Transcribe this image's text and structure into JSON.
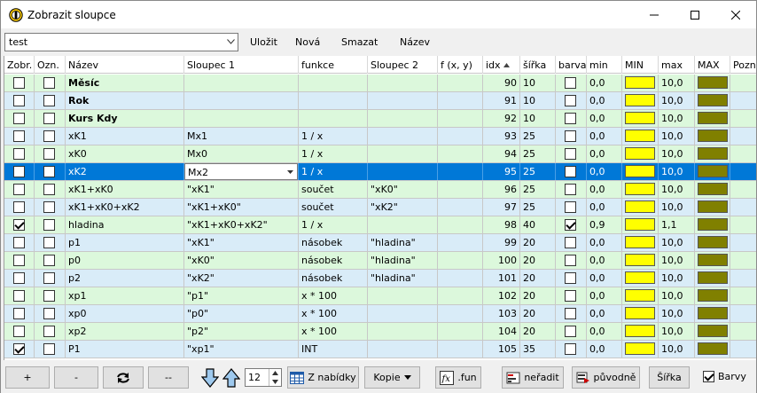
{
  "window": {
    "title": "Zobrazit sloupce",
    "app_icon": "app-logo-icon",
    "controls": [
      "minimize-icon",
      "maximize-icon",
      "close-icon"
    ]
  },
  "toolbar": {
    "preset_value": "test",
    "save_label": "Uložit",
    "new_label": "Nová",
    "delete_label": "Smazat",
    "rename_label": "Název"
  },
  "grid": {
    "columns": [
      {
        "key": "zobr",
        "label": "Zobr."
      },
      {
        "key": "ozn",
        "label": "Ozn."
      },
      {
        "key": "nazev",
        "label": "Název"
      },
      {
        "key": "s1",
        "label": "Sloupec 1"
      },
      {
        "key": "fn",
        "label": "funkce"
      },
      {
        "key": "s2",
        "label": "Sloupec 2"
      },
      {
        "key": "fxy",
        "label": "f (x, y)"
      },
      {
        "key": "idx",
        "label": "idx"
      },
      {
        "key": "sirka",
        "label": "šířka"
      },
      {
        "key": "barva",
        "label": "barva"
      },
      {
        "key": "min",
        "label": "min"
      },
      {
        "key": "MIN",
        "label": "MIN"
      },
      {
        "key": "max",
        "label": "max"
      },
      {
        "key": "MAX",
        "label": "MAX"
      },
      {
        "key": "pozn",
        "label": "Pozná"
      }
    ],
    "sorted_column": "idx",
    "sort_direction": "ascending",
    "min_color": "#ffff00",
    "max_color": "#808000",
    "selected_row_color": "#0078d7",
    "row_colors": {
      "green": "#dcf8dc",
      "blue": "#d9ecf8"
    },
    "rows": [
      {
        "zobr": false,
        "ozn": false,
        "nazev": "Měsíc",
        "bold": true,
        "s1": "",
        "fn": "",
        "s2": "",
        "fxy": "",
        "idx": "90",
        "sirka": "10",
        "barva": false,
        "min": "0,0",
        "max": "10,0",
        "tint": "green"
      },
      {
        "zobr": false,
        "ozn": false,
        "nazev": "Rok",
        "bold": true,
        "s1": "",
        "fn": "",
        "s2": "",
        "fxy": "",
        "idx": "91",
        "sirka": "10",
        "barva": false,
        "min": "0,0",
        "max": "10,0",
        "tint": "blue"
      },
      {
        "zobr": false,
        "ozn": false,
        "nazev": "Kurs Kdy",
        "bold": true,
        "s1": "",
        "fn": "",
        "s2": "",
        "fxy": "",
        "idx": "92",
        "sirka": "10",
        "barva": false,
        "min": "0,0",
        "max": "10,0",
        "tint": "green"
      },
      {
        "zobr": false,
        "ozn": false,
        "nazev": "xK1",
        "bold": false,
        "s1": "Mx1",
        "fn": "1 / x",
        "s2": "",
        "fxy": "",
        "idx": "93",
        "sirka": "25",
        "barva": false,
        "min": "0,0",
        "max": "10,0",
        "tint": "blue"
      },
      {
        "zobr": false,
        "ozn": false,
        "nazev": "xK0",
        "bold": false,
        "s1": "Mx0",
        "fn": "1 / x",
        "s2": "",
        "fxy": "",
        "idx": "94",
        "sirka": "25",
        "barva": false,
        "min": "0,0",
        "max": "10,0",
        "tint": "green"
      },
      {
        "zobr": false,
        "ozn": false,
        "nazev": "xK2",
        "bold": false,
        "s1": "Mx2",
        "fn": "1 / x",
        "s2": "",
        "fxy": "",
        "idx": "95",
        "sirka": "25",
        "barva": false,
        "min": "0,0",
        "max": "10,0",
        "tint": "selected",
        "editing": true
      },
      {
        "zobr": false,
        "ozn": false,
        "nazev": "xK1+xK0",
        "bold": false,
        "s1": "\"xK1\"",
        "fn": "součet",
        "s2": "\"xK0\"",
        "fxy": "",
        "idx": "96",
        "sirka": "25",
        "barva": false,
        "min": "0,0",
        "max": "10,0",
        "tint": "green"
      },
      {
        "zobr": false,
        "ozn": false,
        "nazev": "xK1+xK0+xK2",
        "bold": false,
        "s1": "\"xK1+xK0\"",
        "fn": "součet",
        "s2": "\"xK2\"",
        "fxy": "",
        "idx": "97",
        "sirka": "25",
        "barva": false,
        "min": "0,0",
        "max": "10,0",
        "tint": "blue"
      },
      {
        "zobr": true,
        "ozn": false,
        "nazev": "hladina",
        "bold": false,
        "s1": "\"xK1+xK0+xK2\"",
        "fn": "1 / x",
        "s2": "",
        "fxy": "",
        "idx": "98",
        "sirka": "40",
        "barva": true,
        "min": "0,9",
        "max": "1,1",
        "tint": "green"
      },
      {
        "zobr": false,
        "ozn": false,
        "nazev": "p1",
        "bold": false,
        "s1": "\"xK1\"",
        "fn": "násobek",
        "s2": "\"hladina\"",
        "fxy": "",
        "idx": "99",
        "sirka": "20",
        "barva": false,
        "min": "0,0",
        "max": "10,0",
        "tint": "blue"
      },
      {
        "zobr": false,
        "ozn": false,
        "nazev": "p0",
        "bold": false,
        "s1": "\"xK0\"",
        "fn": "násobek",
        "s2": "\"hladina\"",
        "fxy": "",
        "idx": "100",
        "sirka": "20",
        "barva": false,
        "min": "0,0",
        "max": "10,0",
        "tint": "green"
      },
      {
        "zobr": false,
        "ozn": false,
        "nazev": "p2",
        "bold": false,
        "s1": "\"xK2\"",
        "fn": "násobek",
        "s2": "\"hladina\"",
        "fxy": "",
        "idx": "101",
        "sirka": "20",
        "barva": false,
        "min": "0,0",
        "max": "10,0",
        "tint": "blue"
      },
      {
        "zobr": false,
        "ozn": false,
        "nazev": "xp1",
        "bold": false,
        "s1": "\"p1\"",
        "fn": "x * 100",
        "s2": "",
        "fxy": "",
        "idx": "102",
        "sirka": "20",
        "barva": false,
        "min": "0,0",
        "max": "10,0",
        "tint": "green"
      },
      {
        "zobr": false,
        "ozn": false,
        "nazev": "xp0",
        "bold": false,
        "s1": "\"p0\"",
        "fn": "x * 100",
        "s2": "",
        "fxy": "",
        "idx": "103",
        "sirka": "20",
        "barva": false,
        "min": "0,0",
        "max": "10,0",
        "tint": "blue"
      },
      {
        "zobr": false,
        "ozn": false,
        "nazev": "xp2",
        "bold": false,
        "s1": "\"p2\"",
        "fn": "x * 100",
        "s2": "",
        "fxy": "",
        "idx": "104",
        "sirka": "20",
        "barva": false,
        "min": "0,0",
        "max": "10,0",
        "tint": "green"
      },
      {
        "zobr": true,
        "ozn": false,
        "nazev": "P1",
        "bold": false,
        "s1": "\"xp1\"",
        "fn": "INT",
        "s2": "",
        "fxy": "",
        "idx": "105",
        "sirka": "35",
        "barva": false,
        "min": "0,0",
        "max": "10,0",
        "tint": "blue"
      }
    ]
  },
  "bottom": {
    "add_label": "+",
    "remove_label": "-",
    "refresh_icon": "refresh-icon",
    "clear_label": "--",
    "move_down_icon": "arrow-down-icon",
    "move_up_icon": "arrow-up-icon",
    "spin_value": "12",
    "from_menu_label": "Z nabídky",
    "copy_label": "Kopie",
    "fun_label": ".fun",
    "no_sort_label": "neřadit",
    "original_label": "původně",
    "width_label": "Šířka",
    "colors_label": "Barvy",
    "colors_checked": true
  }
}
